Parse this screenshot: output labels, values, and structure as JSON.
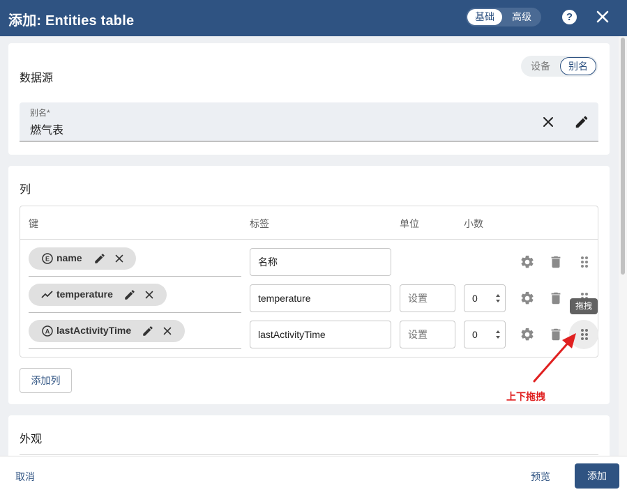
{
  "dialog": {
    "title": "添加: Entities table"
  },
  "mode_toggle": {
    "basic": "基础",
    "advanced": "高级"
  },
  "header_icons": {
    "help": "help-icon",
    "close": "close-icon"
  },
  "datasource": {
    "title": "数据源",
    "toggle": {
      "device": "设备",
      "alias": "别名"
    },
    "alias_field": {
      "label": "别名*",
      "value": "燃气表"
    }
  },
  "columns": {
    "title": "列",
    "headers": {
      "key": "键",
      "label": "标签",
      "unit": "单位",
      "decimals": "小数"
    },
    "rows": [
      {
        "key": "name",
        "key_icon": "entity-field-icon",
        "label": "名称",
        "unit": "",
        "decimals": ""
      },
      {
        "key": "temperature",
        "key_icon": "timeseries-icon",
        "label": "temperature",
        "unit": "设置",
        "decimals": "0"
      },
      {
        "key": "lastActivityTime",
        "key_icon": "attribute-icon",
        "label": "lastActivityTime",
        "unit": "设置",
        "decimals": "0"
      }
    ],
    "add_button": "添加列"
  },
  "appearance": {
    "title": "外观"
  },
  "tooltip": "拖拽",
  "annotation": "上下拖拽",
  "footer": {
    "cancel": "取消",
    "preview": "预览",
    "add": "添加"
  },
  "colors": {
    "primary": "#2f5382",
    "annotation": "#e02020"
  }
}
